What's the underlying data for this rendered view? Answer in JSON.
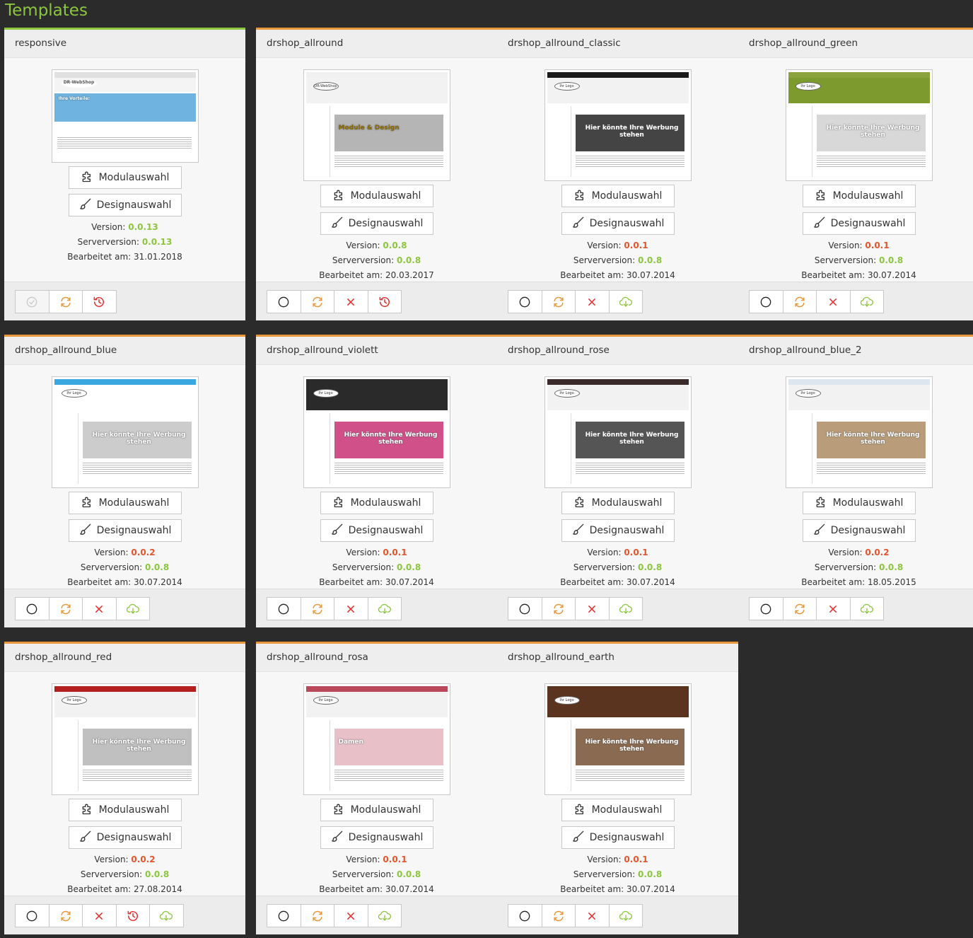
{
  "page": {
    "title": "Templates"
  },
  "labels": {
    "module_button": "Modulauswahl",
    "design_button": "Designauswahl",
    "version_label": "Version: ",
    "server_version_label": "Serverversion: ",
    "edited_label": "Bearbeitet am: "
  },
  "colors": {
    "accent_green": "#8cc63f",
    "accent_orange": "#e8973a",
    "accent_red": "#e2552c"
  },
  "templates": [
    {
      "name": "responsive",
      "version": "0.0.13",
      "version_status": "current",
      "server_version": "0.0.13",
      "edited": "31.01.2018",
      "preview_text": [
        "DR-WebShop",
        "Ihre Vorteile:"
      ],
      "actions": [
        "check-disabled",
        "refresh",
        "restore"
      ]
    },
    {
      "name": "drshop_allround",
      "version": "0.0.8",
      "version_status": "current",
      "server_version": "0.0.8",
      "edited": "20.03.2017",
      "preview_text": [
        "DR-WebShop",
        "Module & Design"
      ],
      "actions": [
        "select",
        "refresh",
        "delete",
        "restore"
      ]
    },
    {
      "name": "drshop_allround_classic",
      "version": "0.0.1",
      "version_status": "outdated",
      "server_version": "0.0.8",
      "edited": "30.07.2014",
      "preview_text": [
        "Ihr Logo",
        "Hier könnte Ihre Werbung stehen"
      ],
      "actions": [
        "select",
        "refresh",
        "delete",
        "download"
      ]
    },
    {
      "name": "drshop_allround_green",
      "version": "0.0.1",
      "version_status": "outdated",
      "server_version": "0.0.8",
      "edited": "30.07.2014",
      "preview_text": [
        "Ihr Logo",
        "Hier könnte Ihre Werbung stehen"
      ],
      "actions": [
        "select",
        "refresh",
        "delete",
        "download"
      ]
    },
    {
      "name": "drshop_allround_blue",
      "version": "0.0.2",
      "version_status": "outdated",
      "server_version": "0.0.8",
      "edited": "30.07.2014",
      "preview_text": [
        "Ihr Logo",
        "Hier könnte Ihre Werbung stehen"
      ],
      "actions": [
        "select",
        "refresh",
        "delete",
        "download"
      ]
    },
    {
      "name": "drshop_allround_violett",
      "version": "0.0.1",
      "version_status": "outdated",
      "server_version": "0.0.8",
      "edited": "30.07.2014",
      "preview_text": [
        "Ihr Logo",
        "Hier könnte Ihre Werbung stehen"
      ],
      "actions": [
        "select",
        "refresh",
        "delete",
        "download"
      ]
    },
    {
      "name": "drshop_allround_rose",
      "version": "0.0.1",
      "version_status": "outdated",
      "server_version": "0.0.8",
      "edited": "30.07.2014",
      "preview_text": [
        "Ihr Logo",
        "Hier könnte Ihre Werbung stehen"
      ],
      "actions": [
        "select",
        "refresh",
        "delete",
        "download"
      ]
    },
    {
      "name": "drshop_allround_blue_2",
      "version": "0.0.2",
      "version_status": "outdated",
      "server_version": "0.0.8",
      "edited": "18.05.2015",
      "preview_text": [
        "Ihr Logo",
        "Hier könnte Ihre Werbung stehen"
      ],
      "actions": [
        "select",
        "refresh",
        "delete",
        "download"
      ]
    },
    {
      "name": "drshop_allround_red",
      "version": "0.0.2",
      "version_status": "outdated",
      "server_version": "0.0.8",
      "edited": "27.08.2014",
      "preview_text": [
        "Ihr Logo",
        "Hier könnte Ihre Werbung stehen"
      ],
      "actions": [
        "select",
        "refresh",
        "delete",
        "restore",
        "download"
      ]
    },
    {
      "name": "drshop_allround_rosa",
      "version": "0.0.1",
      "version_status": "outdated",
      "server_version": "0.0.8",
      "edited": "30.07.2014",
      "preview_text": [
        "Ihr Logo",
        "Damen"
      ],
      "actions": [
        "select",
        "refresh",
        "delete",
        "download"
      ]
    },
    {
      "name": "drshop_allround_earth",
      "version": "0.0.1",
      "version_status": "outdated",
      "server_version": "0.0.8",
      "edited": "30.07.2014",
      "preview_text": [
        "Ihr Logo",
        "Hier könnte Ihre Werbung stehen"
      ],
      "actions": [
        "select",
        "refresh",
        "delete",
        "download"
      ]
    }
  ],
  "preview_themes": [
    {
      "bar": "#e0e0e0",
      "nav": "#dddddd",
      "banner": "#6fb3e0"
    },
    {
      "bar": "#f0f0f0",
      "nav": "#666666",
      "banner": "#b5b5b5"
    },
    {
      "bar": "#1a1a1a",
      "nav": "#ffffff",
      "banner": "#444444"
    },
    {
      "bar": "#8aa33c",
      "nav": "#7d9a2f",
      "banner": "#d8d8d8"
    },
    {
      "bar": "#3aa7e0",
      "nav": "#3d9bd7",
      "banner": "#cccccc"
    },
    {
      "bar": "#2a2a2a",
      "nav": "#9b7bc0",
      "banner": "#d0508a"
    },
    {
      "bar": "#3a2a2a",
      "nav": "#c98585",
      "banner": "#555555"
    },
    {
      "bar": "#dde6ef",
      "nav": "#4c7eaa",
      "banner": "#b99d7a"
    },
    {
      "bar": "#b31e1e",
      "nav": "#c72626",
      "banner": "#c0c0c0"
    },
    {
      "bar": "#b8485a",
      "nav": "#d98c98",
      "banner": "#e8c0c8"
    },
    {
      "bar": "#5a341f",
      "nav": "#c78b5a",
      "banner": "#8a6a50"
    }
  ]
}
